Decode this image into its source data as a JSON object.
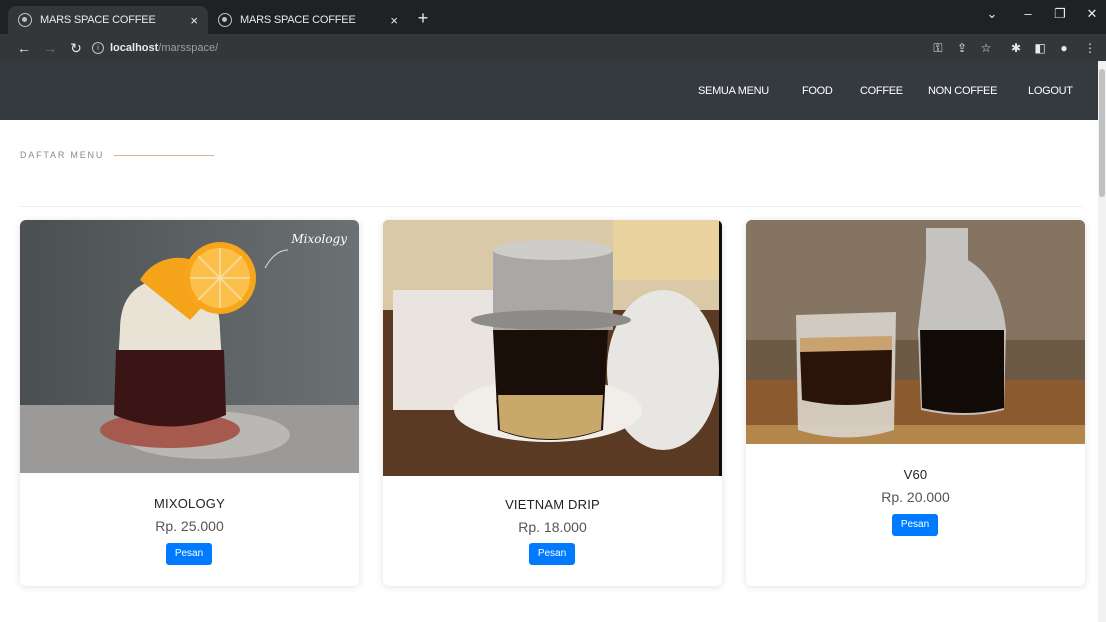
{
  "browser": {
    "tabs": [
      {
        "title": "MARS SPACE COFFEE",
        "active": true
      },
      {
        "title": "MARS SPACE COFFEE",
        "active": false
      }
    ],
    "new_tab": "+",
    "close": "×",
    "url_host": "localhost",
    "url_path": "/marsspace/"
  },
  "nav": {
    "items": [
      "SEMUA MENU",
      "FOOD",
      "COFFEE",
      "NON COFFEE",
      "LOGOUT"
    ]
  },
  "section": {
    "title": "DAFTAR MENU"
  },
  "products": [
    {
      "name": "MIXOLOGY",
      "price": "Rp. 25.000",
      "button": "Pesan",
      "image_caption": "Mixology"
    },
    {
      "name": "VIETNAM DRIP",
      "price": "Rp. 18.000",
      "button": "Pesan"
    },
    {
      "name": "V60",
      "price": "Rp. 20.000",
      "button": "Pesan"
    }
  ],
  "colors": {
    "navbar": "#343a40",
    "button": "#007bff",
    "chrome": "#202124"
  }
}
